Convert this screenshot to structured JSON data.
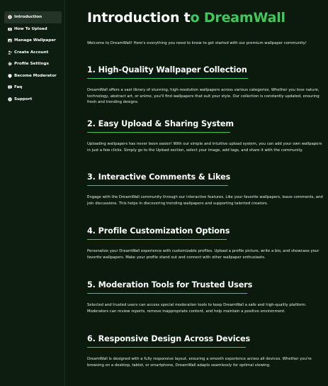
{
  "sidebar": {
    "items": [
      {
        "label": "Introduction",
        "icon": "info-icon"
      },
      {
        "label": "How To Upload",
        "icon": "upload-icon"
      },
      {
        "label": "Manage Wallpaper",
        "icon": "image-icon"
      },
      {
        "label": "Create Account",
        "icon": "user-plus-icon"
      },
      {
        "label": "Profile Settings",
        "icon": "gear-icon"
      },
      {
        "label": "Become Moderator",
        "icon": "shield-icon"
      },
      {
        "label": "Faq",
        "icon": "question-icon"
      },
      {
        "label": "Support",
        "icon": "help-circle-icon"
      }
    ]
  },
  "main": {
    "title_prefix": "Introduction t",
    "title_accent": "o DreamWall",
    "intro": "Welcome to DreamWall! Here's everything you need to know to get started with our premium wallpaper community!",
    "sections": [
      {
        "heading": "1. High-Quality Wallpaper Collection",
        "body": "DreamWall offers a vast library of stunning, high-resolution wallpapers across various categories. Whether you love nature, technology, abstract art, or anime, you'll find wallpapers that suit your style. Our collection is constantly updated, ensuring fresh and trending designs."
      },
      {
        "heading": "2. Easy Upload & Sharing System",
        "body": "Uploading wallpapers has never been easier! With our simple and intuitive upload system, you can add your own wallpapers in just a few clicks. Simply go to the Upload section, select your image, add tags, and share it with the community."
      },
      {
        "heading": "3. Interactive Comments & Likes",
        "body": "Engage with the DreamWall community through our interactive features. Like your favorite wallpapers, leave comments, and join discussions. This helps in discovering trending wallpapers and supporting talented creators."
      },
      {
        "heading": "4. Profile Customization Options",
        "body": "Personalize your DreamWall experience with customizable profiles. Upload a profile picture, write a bio, and showcase your favorite wallpapers. Make your profile stand out and connect with other wallpaper enthusiasts."
      },
      {
        "heading": "5. Moderation Tools for Trusted Users",
        "body": "Selected and trusted users can access special moderation tools to keep DreamWall a safe and high-quality platform. Moderators can review reports, remove inappropriate content, and help maintain a positive environment."
      },
      {
        "heading": "6. Responsive Design Across Devices",
        "body": "DreamWall is designed with a fully responsive layout, ensuring a smooth experience across all devices. Whether you're browsing on a desktop, tablet, or smartphone, DreamWall adapts seamlessly for optimal viewing."
      }
    ]
  },
  "colors": {
    "background": "#0b1a0d",
    "accent": "#3ec95a",
    "active_item": "#243427"
  }
}
